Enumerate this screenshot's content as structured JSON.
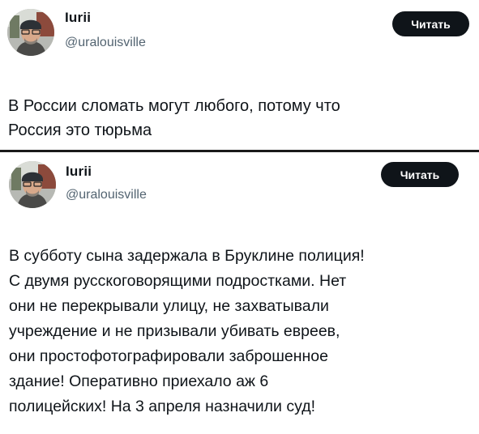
{
  "posts": [
    {
      "author_name": "Iurii",
      "handle": "@uralouisville",
      "follow_label": "Читать",
      "text": "В России сломать могут любого, потому что\nРоссия это тюрьма"
    },
    {
      "author_name": "Iurii",
      "handle": "@uralouisville",
      "follow_label": "Читать",
      "text": "В субботу сына задержала в Бруклине полиция!\nС двумя русскоговорящими подростками. Нет\nони не перекрывали улицу, не захватывали\nучреждение и не призывали убивать евреев,\nони простофотографировали заброшенное\nздание! Оперативно приехало аж 6\nполицейских! На 3 апреля назначили суд!"
    }
  ],
  "colors": {
    "button_bg": "#0f1419",
    "button_text": "#ffffff",
    "handle_gray": "#536471",
    "divider": "#1a1a1a"
  },
  "icons": {
    "avatar": "user-photo-avatar"
  }
}
